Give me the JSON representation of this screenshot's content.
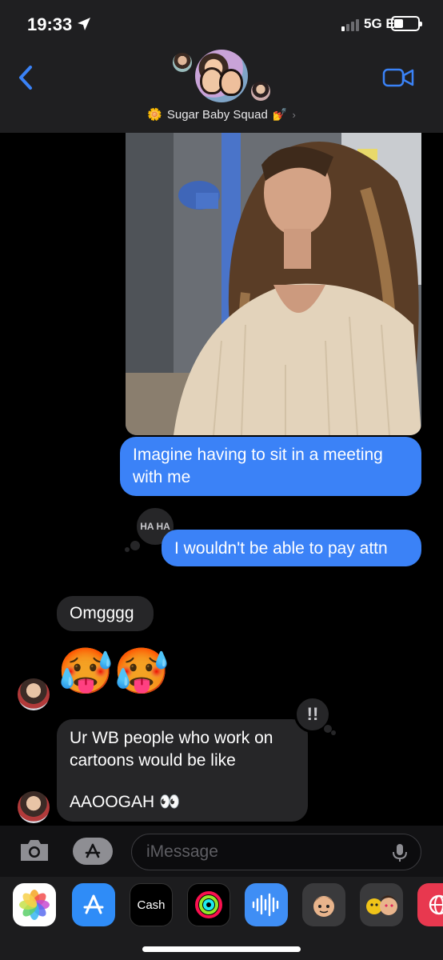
{
  "status": {
    "time": "19:33",
    "network": "5G E"
  },
  "conversation": {
    "name": "Sugar Baby Squad",
    "name_prefix_emoji": "🌼",
    "name_suffix_emoji": "💅"
  },
  "messages": {
    "sent_1": "Imagine having to sit in a meeting with me",
    "tapback_1": "HA HA",
    "sent_2": "I wouldn't be able to pay attn",
    "recv_1": "Omgggg",
    "emoji_1": "🥵",
    "emoji_2": "🥵",
    "tapback_2": "!!",
    "recv_2_line1": "Ur WB people who work on",
    "recv_2_line2": "cartoons would be like",
    "recv_2_line3": "AAOOGAH 👀"
  },
  "compose": {
    "placeholder": "iMessage"
  },
  "drawer": {
    "apps": [
      {
        "name": "photos-app",
        "icon": "photos-icon"
      },
      {
        "name": "app-store",
        "icon": "app-store-icon"
      },
      {
        "name": "apple-cash",
        "label": "Cash",
        "icon": "apple-cash-icon"
      },
      {
        "name": "activity",
        "icon": "activity-rings-icon"
      },
      {
        "name": "audio-message",
        "icon": "waveform-icon"
      },
      {
        "name": "memoji-1",
        "icon": "memoji-icon"
      },
      {
        "name": "memoji-2",
        "icon": "memoji-stickers-icon"
      },
      {
        "name": "search-web",
        "icon": "globe-icon"
      }
    ]
  },
  "colors": {
    "sent_bubble": "#3b82f7",
    "recv_bubble": "#262628",
    "accent": "#3a82f7",
    "background": "#000000"
  }
}
